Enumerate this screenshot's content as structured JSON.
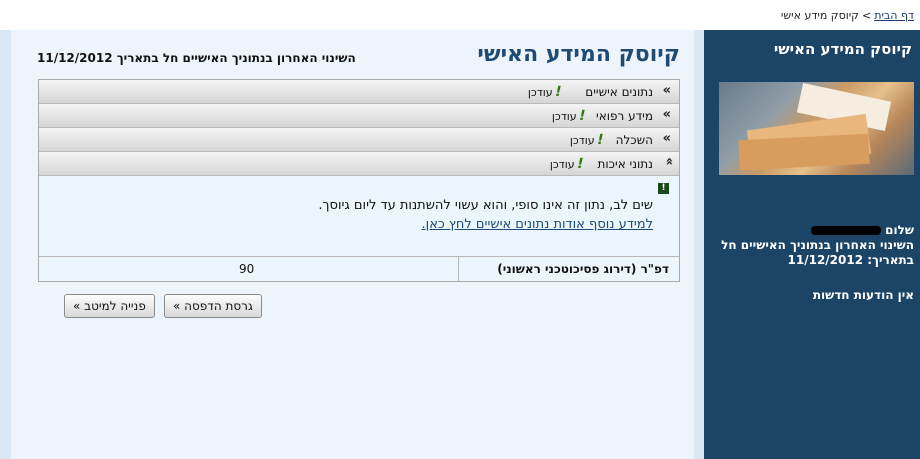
{
  "breadcrumb": {
    "home_label": "דף הבית",
    "separator": ">",
    "current_label": "קיוסק מידע אישי"
  },
  "sidebar": {
    "title": "קיוסק המידע האישי",
    "greeting_prefix": "שלום",
    "last_change_text": "השינוי האחרון בנתוניך האישיים חל בתאריך: 11/12/2012",
    "news_text": "אין הודעות חדשות"
  },
  "main": {
    "title": "קיוסק המידע האישי",
    "last_change_text": "השינוי האחרון בנתוניך האישיים חל בתאריך 11/12/2012",
    "accordion": [
      {
        "arrow": "»",
        "label": "נתונים אישיים",
        "updated": "עודכן"
      },
      {
        "arrow": "»",
        "label": "מידע רפואי",
        "updated": "עודכן"
      },
      {
        "arrow": "»",
        "label": "השכלה",
        "updated": "עודכן"
      },
      {
        "arrow": "»",
        "label": "נתוני איכות",
        "updated": "עודכן",
        "expanded": true
      }
    ],
    "panel": {
      "warning_icon": "!",
      "note": "שים לב, נתון זה אינו סופי, והוא עשוי להשתנות עד ליום גיוסך.",
      "more_link": "למידע נוסף אודות נתונים אישיים לחץ כאן."
    },
    "grade": {
      "label": "דפ\"ר (דירוג פסיכוטכני ראשוני)",
      "value": "90"
    },
    "buttons": {
      "print_label": "גרסת הדפסה »",
      "contact_label": "פנייה למיטב »"
    }
  }
}
